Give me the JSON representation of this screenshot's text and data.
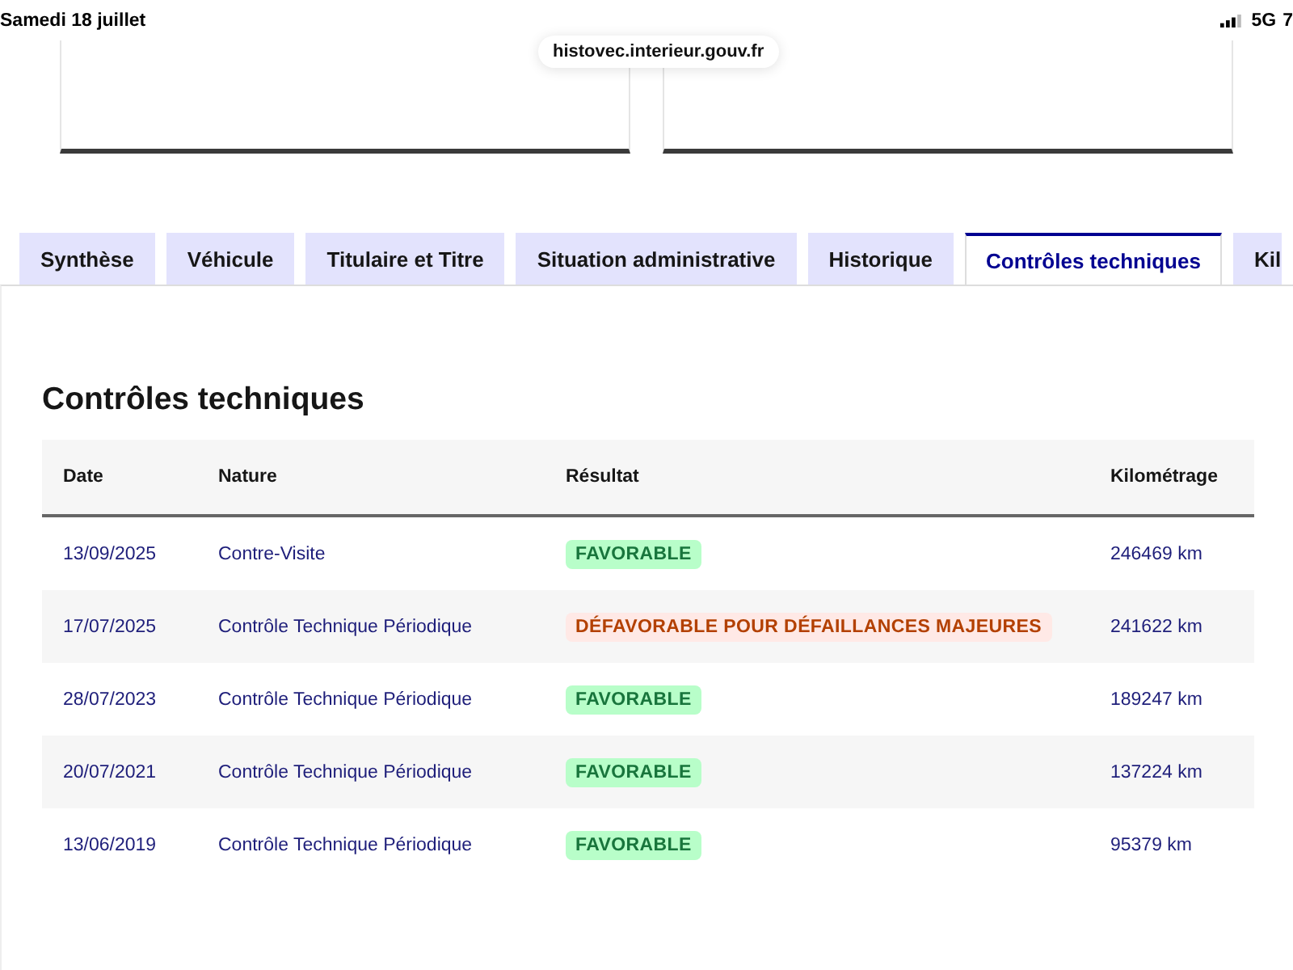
{
  "status_bar": {
    "date": "Samedi 18 juillet",
    "network": "5G",
    "battery": "7"
  },
  "address_bar": {
    "url": "histovec.interieur.gouv.fr"
  },
  "tabs": [
    {
      "label": "Synthèse",
      "selected": false
    },
    {
      "label": "Véhicule",
      "selected": false
    },
    {
      "label": "Titulaire et Titre",
      "selected": false
    },
    {
      "label": "Situation administrative",
      "selected": false
    },
    {
      "label": "Historique",
      "selected": false
    },
    {
      "label": "Contrôles techniques",
      "selected": true
    },
    {
      "label": "Kil",
      "selected": false
    }
  ],
  "section": {
    "title": "Contrôles techniques",
    "table": {
      "columns": [
        "Date",
        "Nature",
        "Résultat",
        "Kilométrage"
      ],
      "rows": [
        {
          "date": "13/09/2025",
          "nature": "Contre-Visite",
          "result": {
            "label": "FAVORABLE",
            "kind": "success"
          },
          "mileage": "246469 km"
        },
        {
          "date": "17/07/2025",
          "nature": "Contrôle Technique Périodique",
          "result": {
            "label": "DÉFAVORABLE POUR DÉFAILLANCES MAJEURES",
            "kind": "error"
          },
          "mileage": "241622 km"
        },
        {
          "date": "28/07/2023",
          "nature": "Contrôle Technique Périodique",
          "result": {
            "label": "FAVORABLE",
            "kind": "success"
          },
          "mileage": "189247 km"
        },
        {
          "date": "20/07/2021",
          "nature": "Contrôle Technique Périodique",
          "result": {
            "label": "FAVORABLE",
            "kind": "success"
          },
          "mileage": "137224 km"
        },
        {
          "date": "13/06/2019",
          "nature": "Contrôle Technique Périodique",
          "result": {
            "label": "FAVORABLE",
            "kind": "success"
          },
          "mileage": "95379 km"
        }
      ]
    }
  }
}
